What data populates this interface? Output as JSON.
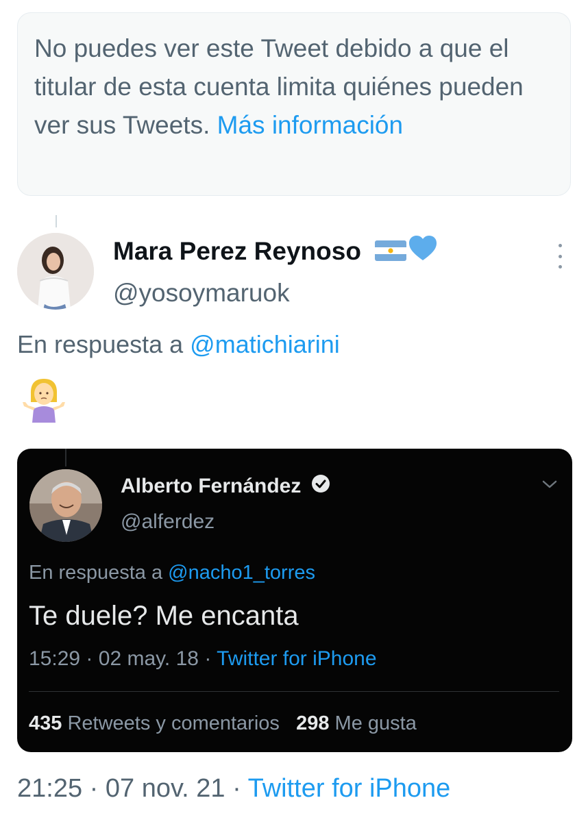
{
  "notice": {
    "text": "No puedes ver este Tweet debido a que el titular de esta cuenta limita quiénes pueden ver sus Tweets.",
    "link": "Más información"
  },
  "tweet": {
    "display_name": "Mara Perez Reynoso",
    "name_emoji": [
      "argentina-flag-icon",
      "blue-heart-icon"
    ],
    "handle": "@yosoymaruok",
    "reply_prefix": "En respuesta a",
    "reply_mention": "@matichiarini",
    "body_emoji": "person-shrugging-icon",
    "time": "21:25",
    "date": "07 nov. 21",
    "source": "Twitter for iPhone"
  },
  "quoted": {
    "display_name": "Alberto Fernández",
    "handle": "@alferdez",
    "reply_prefix": "En respuesta a",
    "reply_mention": "@nacho1_torres",
    "text": "Te duele? Me encanta",
    "time": "15:29",
    "date": "02 may. 18",
    "source": "Twitter for iPhone",
    "retweets_count": "435",
    "retweets_label": "Retweets y comentarios",
    "likes_count": "298",
    "likes_label": "Me gusta"
  },
  "colors": {
    "link": "#1d9bf0",
    "secondary_text": "#536471",
    "primary_text": "#0f1419",
    "embed_background": "#050505"
  },
  "separator": "·"
}
